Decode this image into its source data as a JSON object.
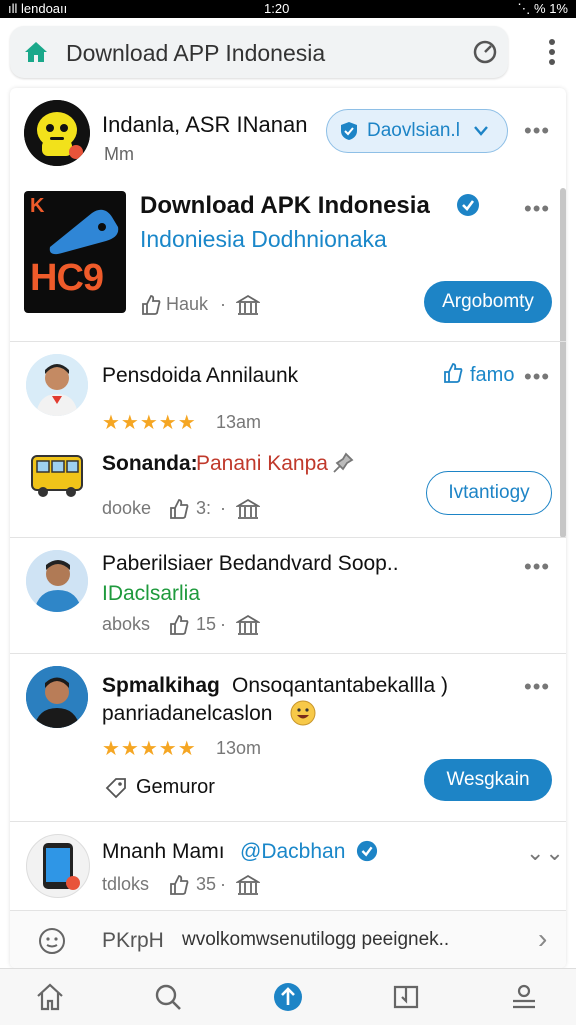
{
  "status_bar": {
    "carrier": "ıll lendoaıı",
    "time": "1:20",
    "battery": "⋱ % 1%"
  },
  "address_bar": {
    "url_text": "Download APP Indonesia"
  },
  "post1": {
    "author": "Indanla, ASR INanan",
    "time": "Mm",
    "pill_label": "Daovlsian.l",
    "more": "•••"
  },
  "app_card": {
    "logo_text": "HC9",
    "logo_letter": "K",
    "name": "Download APK Indonesia",
    "subtitle": "Indoniesia Dodhnionaka",
    "meta_label": "Hauk",
    "dot": "·",
    "button_label": "Argobomty",
    "more": "•••"
  },
  "post2": {
    "author": "Pensdoida Annilaunk",
    "action_label": "famo",
    "stars": "★★★★★",
    "time": "13am",
    "bus_title_a": "Sonanda:",
    "bus_title_b": "Panani Kanpa",
    "meta_left": "dooke",
    "meta_count": "3:",
    "dot": "·",
    "button_label": "Ivtantiogy",
    "more": "•••"
  },
  "post3": {
    "author": "Paberilsiaer Bedandvard Soop..",
    "tagline": "IDaclsarlia",
    "meta_left": "aboks",
    "meta_count": "15",
    "dot": "·",
    "more": "•••"
  },
  "post4": {
    "author_bold": "Spmalkihag",
    "author_rest": "Onsoqantantabekallla )",
    "line2": "panriadanelcaslon",
    "stars": "★★★★★",
    "time": "13om",
    "action_label": "Gemuror",
    "button_label": "Wesgkain",
    "more": "•••"
  },
  "post5": {
    "author": "Mnanh Mamı",
    "handle": "@Dacbhan",
    "meta_left": "tdloks",
    "meta_count": "35",
    "dot": "·",
    "more": "⌄⌄"
  },
  "footer_row": {
    "label": "PKrpH",
    "text": "wvolkomwsenutilogg peeignek..",
    "chevron": "›"
  },
  "colors": {
    "accent": "#1d84c6",
    "star": "#f5a623",
    "verified": "#1d84c6"
  }
}
